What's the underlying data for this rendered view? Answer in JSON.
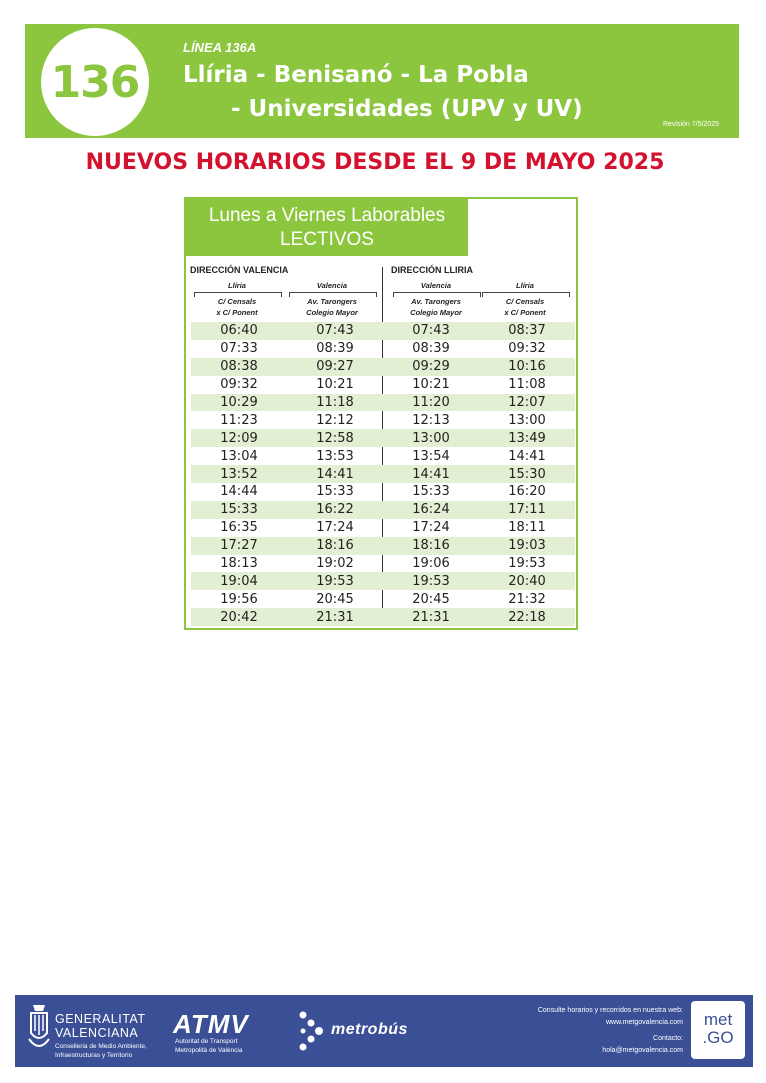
{
  "header": {
    "route_number": "136",
    "line_label": "LÍNEA 136A",
    "title_line1": "Llíria - Benisanó - La Pobla",
    "title_line2": "- Universidades (UPV y UV)",
    "revision": "Revisión 7/5/2025"
  },
  "headline": "NUEVOS HORARIOS DESDE EL 9 DE MAYO 2025",
  "timetable": {
    "day_line1": "Lunes a Viernes Laborables",
    "day_line2": "LECTIVOS",
    "dir_left": "DIRECCIÓN VALENCIA",
    "dir_right": "DIRECCIÓN LLIRIA",
    "columns": [
      {
        "city": "Llíria",
        "stop1": "C/ Censals",
        "stop2": "x C/ Ponent"
      },
      {
        "city": "Valencia",
        "stop1": "Av. Tarongers",
        "stop2": "Colegio Mayor"
      },
      {
        "city": "Valencia",
        "stop1": "Av. Tarongers",
        "stop2": "Colegio Mayor"
      },
      {
        "city": "Llíria",
        "stop1": "C/ Censals",
        "stop2": "x C/ Ponent"
      }
    ],
    "rows": [
      [
        "06:40",
        "07:43",
        "07:43",
        "08:37"
      ],
      [
        "07:33",
        "08:39",
        "08:39",
        "09:32"
      ],
      [
        "08:38",
        "09:27",
        "09:29",
        "10:16"
      ],
      [
        "09:32",
        "10:21",
        "10:21",
        "11:08"
      ],
      [
        "10:29",
        "11:18",
        "11:20",
        "12:07"
      ],
      [
        "11:23",
        "12:12",
        "12:13",
        "13:00"
      ],
      [
        "12:09",
        "12:58",
        "13:00",
        "13:49"
      ],
      [
        "13:04",
        "13:53",
        "13:54",
        "14:41"
      ],
      [
        "13:52",
        "14:41",
        "14:41",
        "15:30"
      ],
      [
        "14:44",
        "15:33",
        "15:33",
        "16:20"
      ],
      [
        "15:33",
        "16:22",
        "16:24",
        "17:11"
      ],
      [
        "16:35",
        "17:24",
        "17:24",
        "18:11"
      ],
      [
        "17:27",
        "18:16",
        "18:16",
        "19:03"
      ],
      [
        "18:13",
        "19:02",
        "19:06",
        "19:53"
      ],
      [
        "19:04",
        "19:53",
        "19:53",
        "20:40"
      ],
      [
        "19:56",
        "20:45",
        "20:45",
        "21:32"
      ],
      [
        "20:42",
        "21:31",
        "21:31",
        "22:18"
      ]
    ]
  },
  "footer": {
    "gva_line1": "GENERALITAT",
    "gva_line2": "VALENCIANA",
    "gva_sub1": "Conselleria de Medio Ambiente,",
    "gva_sub2": "Infraestructuras y Territorio",
    "atmv": "ATMV",
    "atmv_sub1": "Autoritat de Transport",
    "atmv_sub2": "Metropolità de València",
    "metrobus": "metrobús",
    "contact_line1": "Consulte horarios y recorridos en nuestra web:",
    "contact_line2": "www.metgovalencia.com",
    "contact_line3": "Contacto:",
    "contact_line4": "hola@metgovalencia.com",
    "metgo_line1": "met",
    "metgo_line2": ".GO",
    "colors": {
      "brand_green": "#8cc63f",
      "footer_blue": "#3b4f97",
      "headline_red": "#d2122e"
    }
  }
}
